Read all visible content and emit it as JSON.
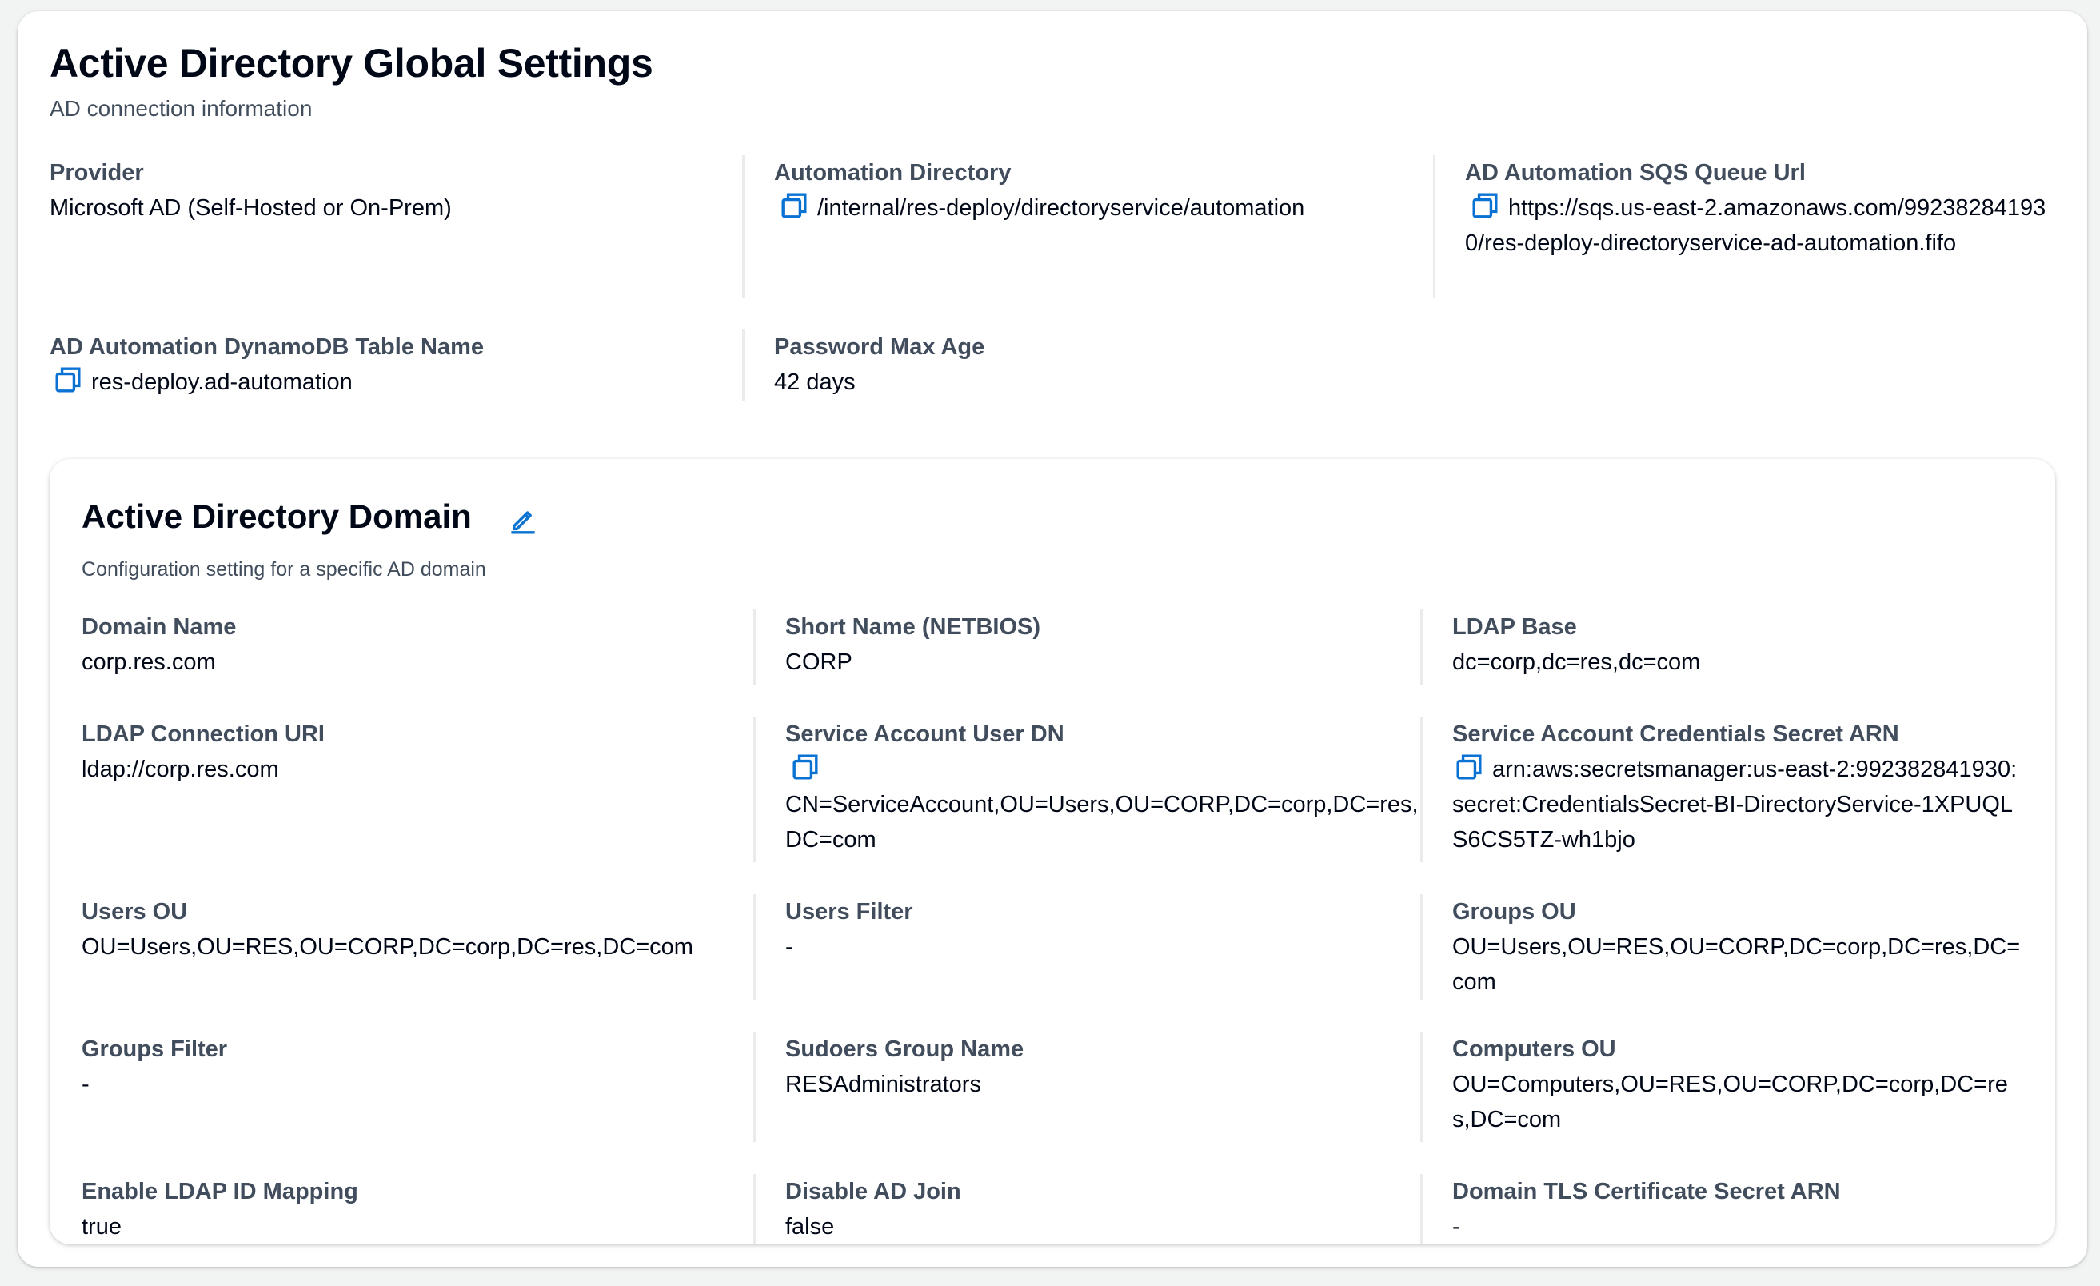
{
  "global": {
    "title": "Active Directory Global Settings",
    "description": "AD connection information",
    "fields": [
      {
        "label": "Provider",
        "value": "Microsoft AD (Self-Hosted or On-Prem)"
      },
      {
        "label": "Automation Directory",
        "value": "/internal/res-deploy/directoryservice/automation"
      },
      {
        "label": "AD Automation SQS Queue Url",
        "value": "https://sqs.us-east-2.amazonaws.com/992382841930/res-deploy-directoryservice-ad-automation.fifo"
      },
      {
        "label": "AD Automation DynamoDB Table Name",
        "value": "res-deploy.ad-automation"
      },
      {
        "label": "Password Max Age",
        "value": "42 days"
      }
    ]
  },
  "domain": {
    "title": "Active Directory Domain",
    "description": "Configuration setting for a specific AD domain",
    "fields": [
      {
        "label": "Domain Name",
        "value": "corp.res.com"
      },
      {
        "label": "Short Name (NETBIOS)",
        "value": "CORP"
      },
      {
        "label": "LDAP Base",
        "value": "dc=corp,dc=res,dc=com"
      },
      {
        "label": "LDAP Connection URI",
        "value": "ldap://corp.res.com"
      },
      {
        "label": "Service Account User DN",
        "value": "CN=ServiceAccount,OU=Users,OU=CORP,DC=corp,DC=res,DC=com"
      },
      {
        "label": "Service Account Credentials Secret ARN",
        "value": "arn:aws:secretsmanager:us-east-2:992382841930:secret:CredentialsSecret-BI-DirectoryService-1XPUQLS6CS5TZ-wh1bjo"
      },
      {
        "label": "Users OU",
        "value": "OU=Users,OU=RES,OU=CORP,DC=corp,DC=res,DC=com"
      },
      {
        "label": "Users Filter",
        "value": "-"
      },
      {
        "label": "Groups OU",
        "value": "OU=Users,OU=RES,OU=CORP,DC=corp,DC=res,DC=com"
      },
      {
        "label": "Groups Filter",
        "value": "-"
      },
      {
        "label": "Sudoers Group Name",
        "value": "RESAdministrators"
      },
      {
        "label": "Computers OU",
        "value": "OU=Computers,OU=RES,OU=CORP,DC=corp,DC=res,DC=com"
      },
      {
        "label": "Enable LDAP ID Mapping",
        "value": "true"
      },
      {
        "label": "Disable AD Join",
        "value": "false"
      },
      {
        "label": "Domain TLS Certificate Secret ARN",
        "value": "-"
      }
    ]
  },
  "icons": {
    "copy": "copy-icon",
    "edit": "edit-pencil-icon"
  },
  "colors": {
    "accent": "#0972d3",
    "label": "#414d5c",
    "text": "#000716",
    "divider": "#e9ebed"
  }
}
